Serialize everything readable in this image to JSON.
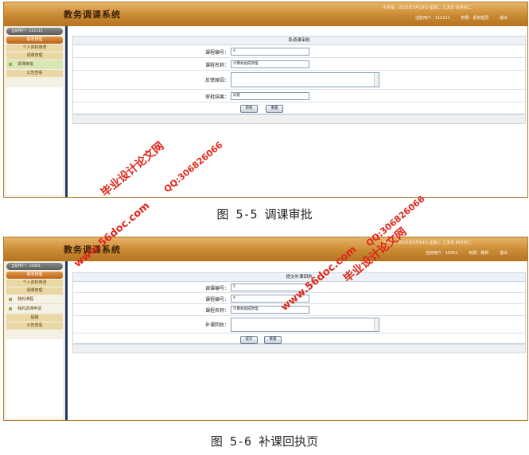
{
  "screens": [
    {
      "app_title": "教务调课系统",
      "date_text": "今天是：2015年5月19日 星期二 乙未年 四月初二",
      "user_text": "当前用户：111111",
      "role_text": "权限：系管理员",
      "logout": "退出",
      "sidebar_user": "当前用户：111111",
      "sidebar_head": "菜单管理",
      "sidebar_items": [
        {
          "label": "个人资料修改",
          "type": "item"
        },
        {
          "label": "调课管理",
          "type": "item"
        },
        {
          "label": "调课审批",
          "type": "sub",
          "active": true
        },
        {
          "label": "公告查看",
          "type": "item"
        }
      ],
      "panel_title": "系调课审批",
      "fields": [
        {
          "label": "课程编号：",
          "value": "4",
          "kind": "input"
        },
        {
          "label": "课程名称：",
          "value": "计算机组成原理",
          "kind": "input"
        },
        {
          "label": "反馈原因：",
          "value": "",
          "kind": "textarea"
        },
        {
          "label": "审批结果：",
          "value": "同意",
          "kind": "input"
        }
      ],
      "buttons": [
        "审批",
        "重置"
      ]
    },
    {
      "app_title": "教务调课系统",
      "date_text": "今天是：2015年5月19日 星期二 乙未年 四月初二",
      "user_text": "当前用户：10001",
      "role_text": "权限：教师",
      "logout": "退出",
      "sidebar_user": "当前用户：10001",
      "sidebar_head": "菜单管理",
      "sidebar_items": [
        {
          "label": "个人资料修改",
          "type": "item"
        },
        {
          "label": "调课管理",
          "type": "item"
        },
        {
          "label": "我的课程",
          "type": "sub"
        },
        {
          "label": "我的调课申请",
          "type": "sub"
        },
        {
          "label": "提醒",
          "type": "item"
        },
        {
          "label": "公告查看",
          "type": "item"
        }
      ],
      "panel_title": "提交补课回执",
      "fields": [
        {
          "label": "调课编号：",
          "value": "5",
          "kind": "input"
        },
        {
          "label": "课程编号：",
          "value": "4",
          "kind": "input"
        },
        {
          "label": "课程名称：",
          "value": "计算机组成原理",
          "kind": "input"
        },
        {
          "label": "补课回执：",
          "value": "",
          "kind": "textarea"
        }
      ],
      "buttons": [
        "提交",
        "重置"
      ]
    }
  ],
  "captions": [
    "图 5-5 调课审批",
    "图 5-6 补课回执页"
  ],
  "watermarks": [
    "毕业设计论文网",
    "QQ:306826066",
    "www.56doc.com"
  ],
  "colors": {
    "header": "#c98a33",
    "sidebar_border": "#1f3a66",
    "watermark": "#e0261b"
  }
}
